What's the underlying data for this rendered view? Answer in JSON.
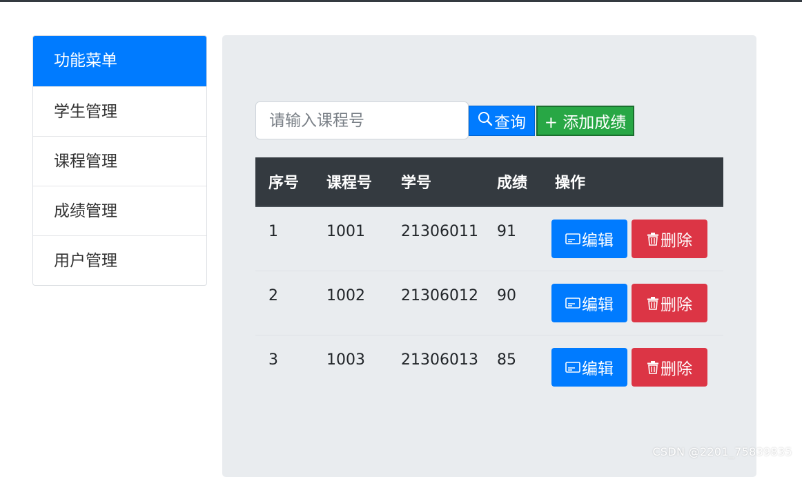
{
  "sidebar": {
    "title": "功能菜单",
    "items": [
      {
        "label": "学生管理"
      },
      {
        "label": "课程管理"
      },
      {
        "label": "成绩管理"
      },
      {
        "label": "用户管理"
      }
    ]
  },
  "toolbar": {
    "search_placeholder": "请输入课程号",
    "search_value": "",
    "search_label": "查询",
    "add_label": "+ 添加成绩",
    "search_icon": "search-icon"
  },
  "table": {
    "headers": [
      "序号",
      "课程号",
      "学号",
      "成绩",
      "操作"
    ],
    "rows": [
      {
        "index": "1",
        "course_id": "1001",
        "student_id": "21306011",
        "grade": "91"
      },
      {
        "index": "2",
        "course_id": "1002",
        "student_id": "21306012",
        "grade": "90"
      },
      {
        "index": "3",
        "course_id": "1003",
        "student_id": "21306013",
        "grade": "85"
      }
    ],
    "edit_label": "编辑",
    "delete_label": "删除",
    "edit_icon": "card-icon",
    "delete_icon": "trash-icon"
  },
  "watermark": "CSDN @2201_75839835",
  "colors": {
    "primary": "#007bff",
    "success": "#28a745",
    "danger": "#dc3545",
    "dark": "#343a40",
    "panel": "#e9ecef"
  }
}
